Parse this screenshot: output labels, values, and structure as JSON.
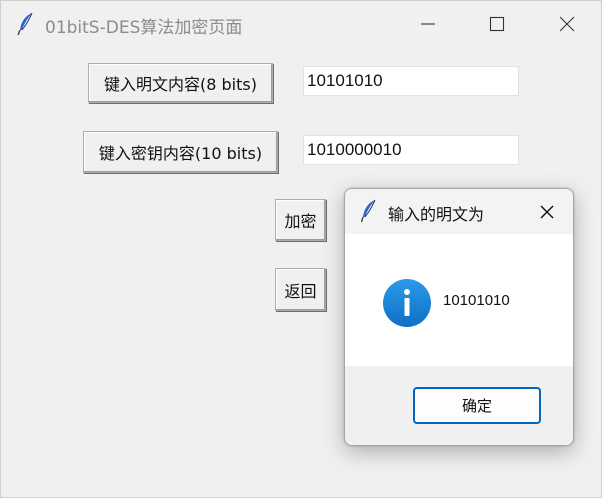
{
  "window": {
    "title": "01bitS-DES算法加密页面",
    "icon": "feather-icon"
  },
  "form": {
    "plaintext_button": "键入明文内容(8 bits)",
    "plaintext_value": "10101010",
    "key_button": "键入密钥内容(10 bits)",
    "key_value": "1010000010",
    "encrypt_button": "加密",
    "back_button": "返回"
  },
  "dialog": {
    "title": "输入的明文为",
    "icon": "info-icon",
    "message": "10101010",
    "ok_button": "确定"
  },
  "colors": {
    "window_bg": "#f0f0f0",
    "info_icon": "#1a7fd4",
    "ok_border": "#0067c0"
  }
}
